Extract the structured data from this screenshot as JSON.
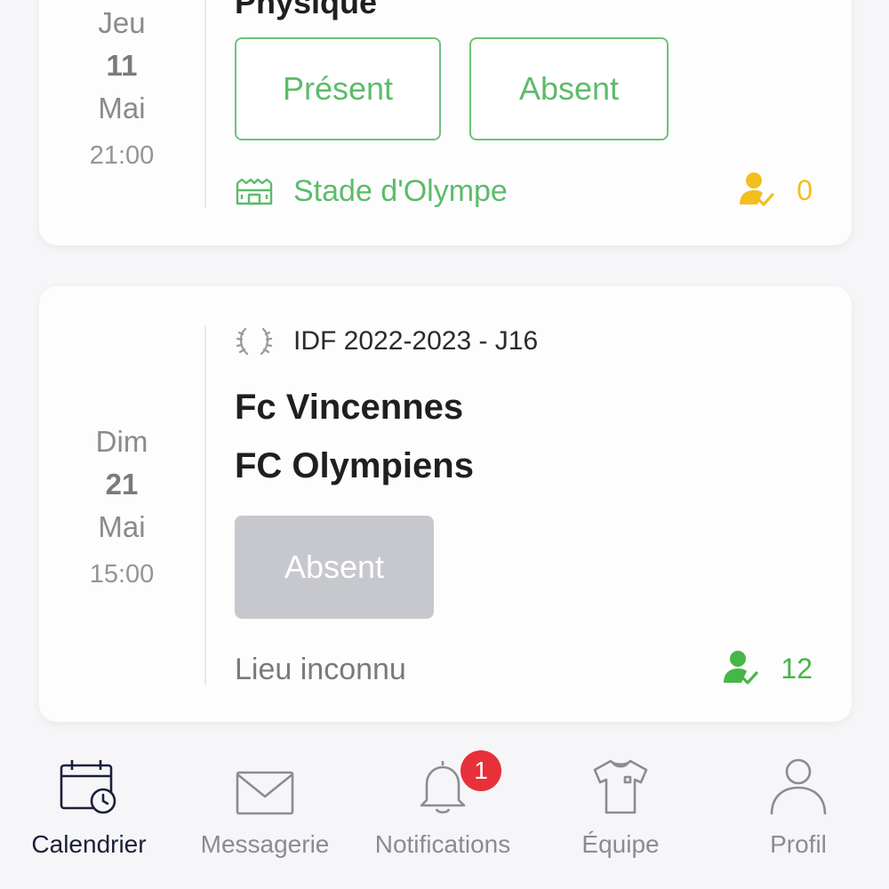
{
  "events": [
    {
      "date": {
        "weekday": "Jeu",
        "day": "11",
        "month": "Mai",
        "time": "21:00"
      },
      "title_partial": "Physique",
      "buttons": {
        "present": "Présent",
        "absent": "Absent"
      },
      "venue": "Stade d'Olympe",
      "attendance_count": "0"
    },
    {
      "date": {
        "weekday": "Dim",
        "day": "21",
        "month": "Mai",
        "time": "15:00"
      },
      "league": "IDF 2022-2023 - J16",
      "home_team": "Fc Vincennes",
      "away_team": "FC Olympiens",
      "status_button": "Absent",
      "venue": "Lieu inconnu",
      "attendance_count": "12"
    }
  ],
  "tabbar": {
    "tabs": [
      {
        "label": "Calendrier",
        "icon": "calendar-icon",
        "active": true
      },
      {
        "label": "Messagerie",
        "icon": "envelope-icon"
      },
      {
        "label": "Notifications",
        "icon": "bell-icon",
        "badge": "1"
      },
      {
        "label": "Équipe",
        "icon": "jersey-icon"
      },
      {
        "label": "Profil",
        "icon": "user-icon"
      }
    ]
  },
  "colors": {
    "accent_green": "#5dbb6a",
    "attendance_yellow": "#f3bf1d",
    "attendance_green": "#46b648",
    "badge_red": "#e8303a",
    "active_tab": "#1b1f3b"
  }
}
